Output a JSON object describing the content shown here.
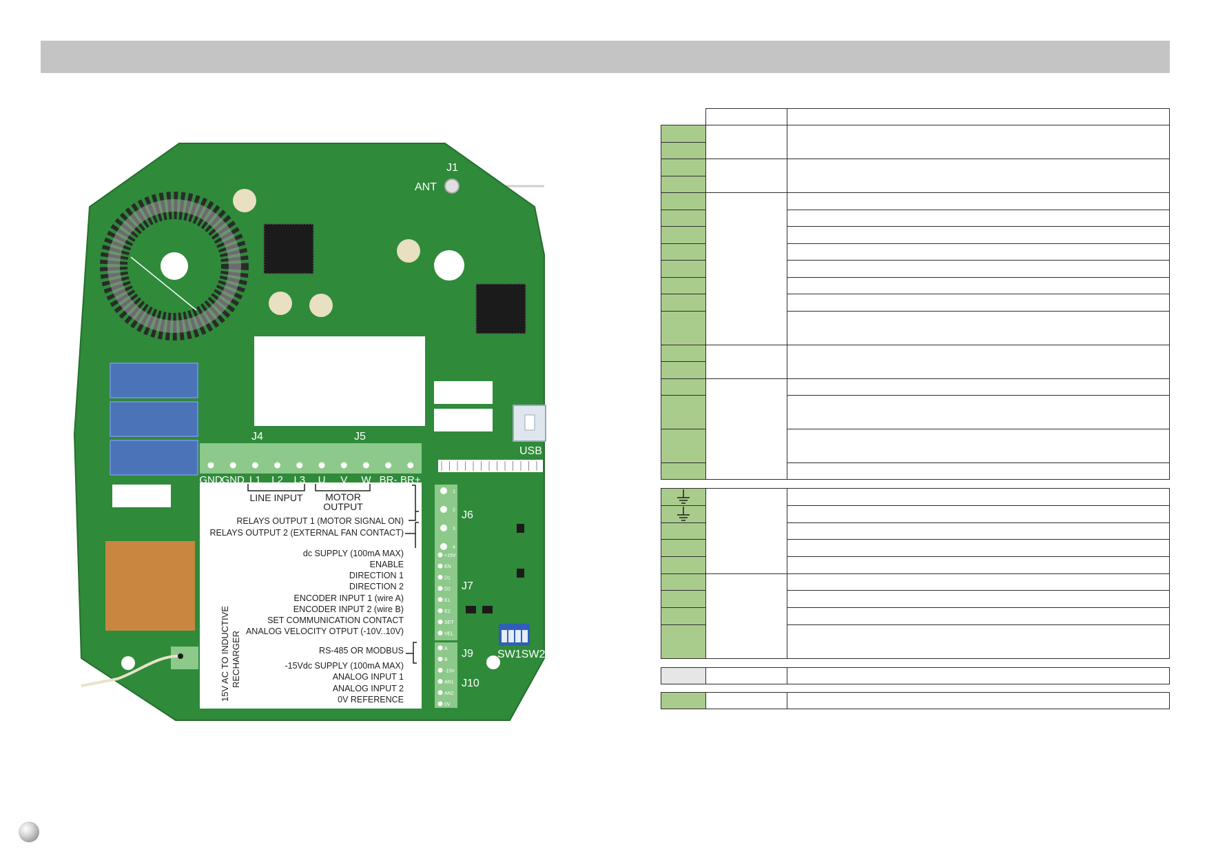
{
  "board": {
    "labels": {
      "j1": "J1",
      "ant": "ANT",
      "j4": "J4",
      "j5": "J5",
      "usb": "USB",
      "j6": "J6",
      "j7": "J7",
      "j9": "J9",
      "j10": "J10",
      "sw": "SW1SW2"
    },
    "terminals_j4_j5": [
      "GND",
      "GND",
      "L1",
      "L2",
      "L3",
      "U",
      "V",
      "W",
      "BR-",
      "BR+"
    ],
    "group_line_input": "LINE INPUT",
    "group_motor_output_1": "MOTOR",
    "group_motor_output_2": "OUTPUT",
    "descriptions": [
      "RELAYS OUTPUT 1 (MOTOR SIGNAL ON)",
      "RELAYS OUTPUT 2 (EXTERNAL FAN CONTACT)",
      "dc SUPPLY (100mA MAX)",
      "ENABLE",
      "DIRECTION 1",
      "DIRECTION 2",
      "ENCODER INPUT 1 (wire A)",
      "ENCODER INPUT 2 (wire B)",
      "SET COMMUNICATION CONTACT",
      "ANALOG VELOCITY OTPUT (-10V..10V)",
      "RS-485 OR MODBUS",
      "-15Vdc SUPPLY (100mA MAX)",
      "ANALOG INPUT 1",
      "ANALOG INPUT 2",
      "0V REFERENCE"
    ],
    "vertical_note_1": "15V AC TO INDUCTIVE",
    "vertical_note_2": "RECHARGER",
    "j7_pins": [
      "+15V",
      "EN",
      "D1",
      "D2",
      "E1",
      "E2",
      "SET",
      "VEL"
    ],
    "j10_pins": [
      "A",
      "B",
      "-15V",
      "AN1",
      "AN2",
      "0V"
    ],
    "j6_pins": [
      "1",
      "2",
      "3",
      "4"
    ]
  },
  "table": {
    "ground_icon": "ground-icon",
    "colors": {
      "green": "#a9cc8d",
      "grey": "#e6e6e6",
      "board": "#2f8a3a",
      "header": "#c4c4c4"
    }
  }
}
